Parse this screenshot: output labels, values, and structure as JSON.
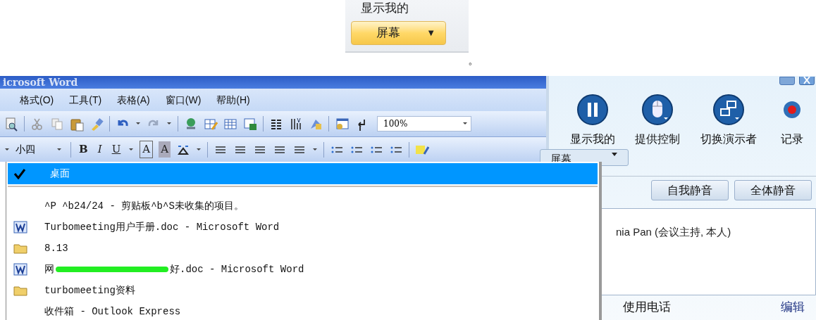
{
  "snippet": {
    "label": "显示我的",
    "button": "屏幕",
    "caret": "▼",
    "trailing": "。"
  },
  "word": {
    "title": "icrosoft Word",
    "menus": [
      "格式(O)",
      "工具(T)",
      "表格(A)",
      "窗口(W)",
      "帮助(H)"
    ],
    "zoom": "100%",
    "font_size": "小四",
    "format_buttons": [
      "B",
      "I",
      "U",
      "A",
      "A"
    ]
  },
  "dropdown": {
    "items": [
      {
        "kind": "check",
        "label": "桌面",
        "selected": true
      },
      {
        "kind": "plain",
        "label": "^P ^b24/24 - 剪贴板^b^S未收集的项目。",
        "selected": false
      },
      {
        "kind": "word",
        "label": "Turbomeeting用户手册.doc - Microsoft Word",
        "selected": false
      },
      {
        "kind": "folder",
        "label": "8.13",
        "selected": false
      },
      {
        "kind": "word",
        "label": "网",
        "label_tail": "好.doc - Microsoft Word",
        "selected": false
      },
      {
        "kind": "folder",
        "label": "turbomeeting资料",
        "selected": false
      },
      {
        "kind": "plain",
        "label": "收件箱 - Outlook Express",
        "selected": false
      }
    ]
  },
  "meeting": {
    "actions": [
      {
        "kind": "pause",
        "label": "显示我的"
      },
      {
        "kind": "mouse",
        "label": "提供控制"
      },
      {
        "kind": "switch",
        "label": "切换演示者"
      },
      {
        "kind": "record",
        "label": "记录"
      }
    ],
    "screen_button": "屏幕",
    "mute_buttons": [
      "自我静音",
      "全体静音"
    ],
    "participant": "nia Pan (会议主持, 本人)",
    "phone": "使用电话",
    "edit": "编辑"
  }
}
